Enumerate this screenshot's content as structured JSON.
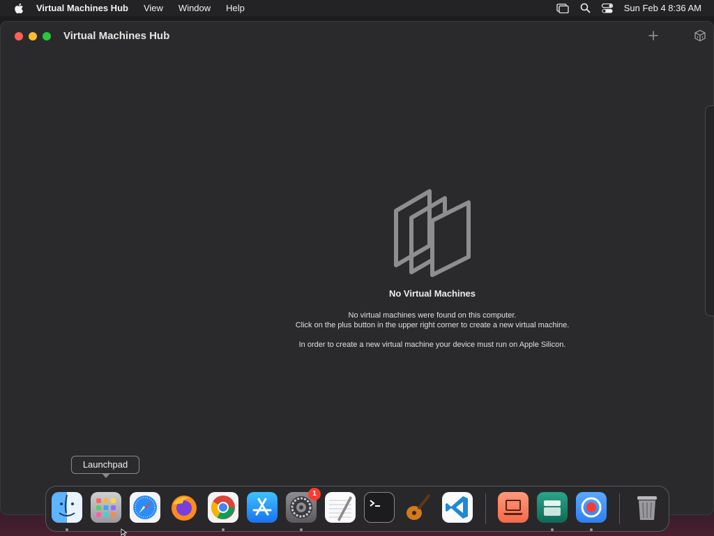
{
  "menubar": {
    "app_name": "Virtual Machines Hub",
    "menus": [
      "View",
      "Window",
      "Help"
    ],
    "clock": "Sun Feb 4  8:36 AM"
  },
  "window": {
    "title": "Virtual Machines Hub"
  },
  "empty_state": {
    "title": "No Virtual Machines",
    "line1": "No virtual machines were found on this computer.",
    "line2": "Click on the plus button in the upper right corner to create a new virtual machine.",
    "line3": "In order to create a new virtual machine your device must run on Apple Silicon."
  },
  "tooltip": {
    "label": "Launchpad"
  },
  "dock": {
    "items": [
      {
        "name": "finder",
        "icon": "finder-icon",
        "running": true
      },
      {
        "name": "launchpad",
        "icon": "launchpad-icon",
        "running": false
      },
      {
        "name": "safari",
        "icon": "safari-icon",
        "running": false
      },
      {
        "name": "firefox",
        "icon": "firefox-icon",
        "running": false
      },
      {
        "name": "chrome",
        "icon": "chrome-icon",
        "running": true
      },
      {
        "name": "app-store",
        "icon": "app-store-icon",
        "running": false
      },
      {
        "name": "system-settings",
        "icon": "gear-icon",
        "running": true,
        "badge": "1"
      },
      {
        "name": "textedit",
        "icon": "textedit-icon",
        "running": false
      },
      {
        "name": "terminal",
        "icon": "terminal-icon",
        "running": false
      },
      {
        "name": "garageband",
        "icon": "guitar-icon",
        "running": false
      },
      {
        "name": "vscode",
        "icon": "vscode-icon",
        "running": false
      },
      {
        "name": "vm-app-1",
        "icon": "laptop-icon",
        "running": false
      },
      {
        "name": "vm-app-2",
        "icon": "archive-icon",
        "running": true
      },
      {
        "name": "screen-recorder",
        "icon": "record-icon",
        "running": true
      },
      {
        "name": "trash",
        "icon": "trash-icon",
        "running": false
      }
    ]
  },
  "colors": {
    "close": "#ff5f57",
    "minimize": "#febc2e",
    "maximize": "#28c840",
    "badge": "#ff3b30"
  }
}
